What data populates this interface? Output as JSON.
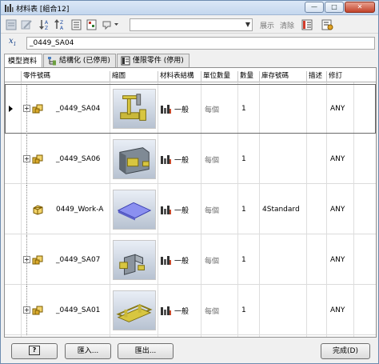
{
  "window": {
    "title": "材料表 [組合12]",
    "controls": {
      "minimize": "—",
      "maximize": "□",
      "close": "✕"
    }
  },
  "toolbar": {
    "part_filter_value": "",
    "show_label": "展示",
    "clear_label": "清除"
  },
  "search": {
    "value": "_0449_SA04"
  },
  "tabs": [
    {
      "label": "模型資料",
      "active": true
    },
    {
      "label": "結構化 (已停用)",
      "active": false
    },
    {
      "label": "僅限零件 (停用)",
      "active": false
    }
  ],
  "table": {
    "columns": [
      "零件號碼",
      "縮圖",
      "材料表結構",
      "單位數量",
      "數量",
      "庫存號碼",
      "描述",
      "修訂"
    ],
    "rows": [
      {
        "part": "_0449_SA04",
        "structure": "一般",
        "unit_qty": "每個",
        "qty": "1",
        "stock": "",
        "desc": "",
        "rev": "ANY",
        "expandable": true,
        "selected": true,
        "thumb": "arm"
      },
      {
        "part": "_0449_SA06",
        "structure": "一般",
        "unit_qty": "每個",
        "qty": "1",
        "stock": "",
        "desc": "",
        "rev": "ANY",
        "expandable": true,
        "selected": false,
        "thumb": "box"
      },
      {
        "part": "0449_Work-A",
        "structure": "一般",
        "unit_qty": "每個",
        "qty": "1",
        "stock": "4Standard",
        "desc": "",
        "rev": "ANY",
        "expandable": false,
        "selected": false,
        "thumb": "plate"
      },
      {
        "part": "_0449_SA07",
        "structure": "一般",
        "unit_qty": "每個",
        "qty": "1",
        "stock": "",
        "desc": "",
        "rev": "ANY",
        "expandable": true,
        "selected": false,
        "thumb": "bracket"
      },
      {
        "part": "_0449_SA01",
        "structure": "一般",
        "unit_qty": "每個",
        "qty": "1",
        "stock": "",
        "desc": "",
        "rev": "ANY",
        "expandable": true,
        "selected": false,
        "thumb": "frame"
      }
    ]
  },
  "footer": {
    "help_label": "?",
    "import_label": "匯入...",
    "export_label": "匯出...",
    "done_label": "完成(D)"
  },
  "colors": {
    "title_bar": "#c4d7ee",
    "assembly_icon": "#e8c04a",
    "thumb_part": "#d8c640"
  }
}
